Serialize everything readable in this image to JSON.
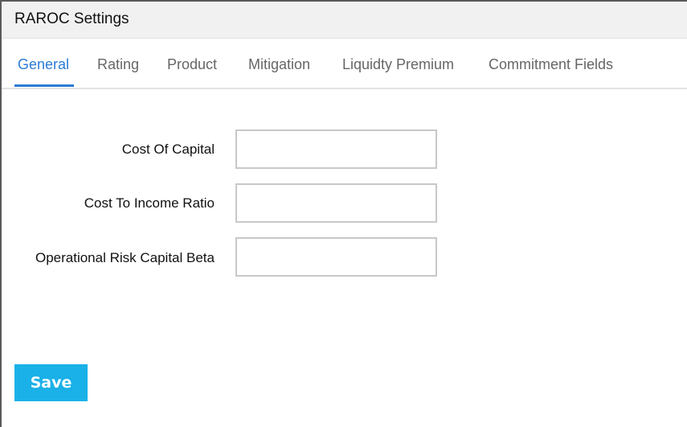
{
  "header": {
    "title": "RAROC Settings"
  },
  "tabs": [
    {
      "label": "General",
      "active": true
    },
    {
      "label": "Rating",
      "active": false
    },
    {
      "label": "Product",
      "active": false
    },
    {
      "label": "Mitigation",
      "active": false
    },
    {
      "label": "Liquidty Premium",
      "active": false
    },
    {
      "label": "Commitment Fields",
      "active": false
    }
  ],
  "form": {
    "fields": [
      {
        "label": "Cost Of Capital",
        "value": ""
      },
      {
        "label": "Cost To Income Ratio",
        "value": ""
      },
      {
        "label": "Operational Risk Capital Beta",
        "value": ""
      }
    ]
  },
  "actions": {
    "save_label": "Save"
  },
  "colors": {
    "accent": "#2c7bd6",
    "save_button": "#1ab1e8"
  }
}
